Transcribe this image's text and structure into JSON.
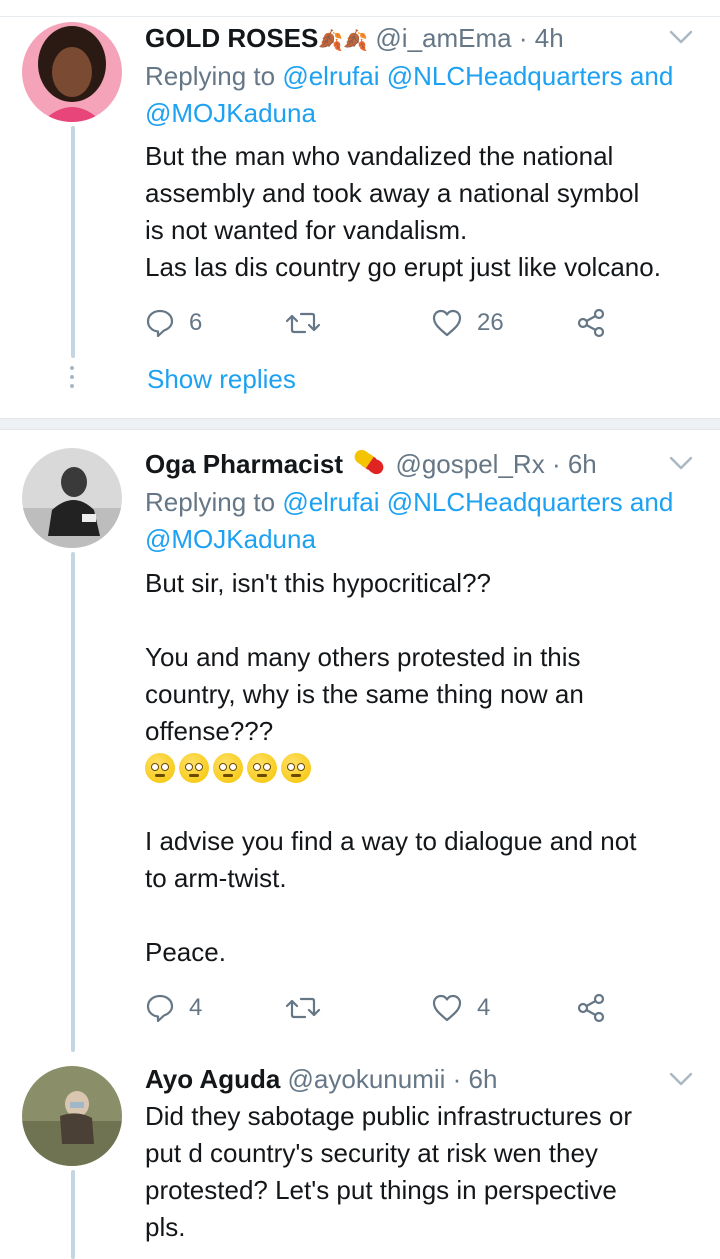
{
  "tweets": [
    {
      "name": "GOLD ROSES",
      "name_emoji": "🍂🍂",
      "handle": "@i_amEma",
      "time": "· 4h",
      "replying_prefix": "Replying to",
      "replying_line1": "@elrufai @NLCHeadquarters and",
      "replying_line2": "@MOJKaduna",
      "text": "But the man who vandalized the national\nassembly and took away a national symbol\nis not wanted for vandalism.\nLas las dis country go erupt just like volcano.",
      "reply_count": "6",
      "retweet_count": "",
      "like_count": "26",
      "show_replies": "Show replies"
    },
    {
      "name": "Oga Pharmacist",
      "name_emoji": "💊",
      "handle": "@gospel_Rx",
      "time": "· 6h",
      "replying_prefix": "Replying to",
      "replying_line1": "@elrufai @NLCHeadquarters and",
      "replying_line2": "@MOJKaduna",
      "text_part1": "But sir, isn't this hypocritical??\n\nYou and many others protested in this\ncountry, why is the same thing now an\noffense???",
      "emoji_row": "🙄🙄🙄🙄🙄",
      "text_part2": "I advise you find a way to dialogue and not\nto arm-twist.\n\nPeace.",
      "reply_count": "4",
      "retweet_count": "",
      "like_count": "4"
    },
    {
      "name": "Ayo Aguda",
      "handle": "@ayokunumii",
      "time": "· 6h",
      "text": "Did they sabotage public infrastructures or\nput d country's security at risk wen they\nprotested? Let's put things in perspective\npls."
    }
  ],
  "colors": {
    "link": "#1da1f2",
    "muted": "#657786",
    "text": "#14171a",
    "thread": "#c4d6e2"
  },
  "icons": [
    "chevron-down-icon",
    "reply-icon",
    "retweet-icon",
    "like-icon",
    "share-icon"
  ]
}
